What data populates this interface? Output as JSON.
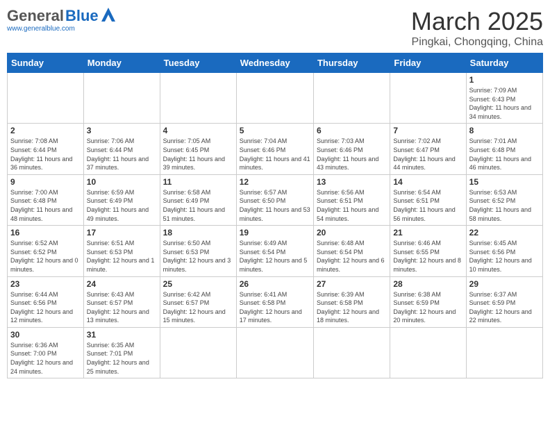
{
  "header": {
    "logo_general": "General",
    "logo_blue": "Blue",
    "month": "March 2025",
    "location": "Pingkai, Chongqing, China"
  },
  "weekdays": [
    "Sunday",
    "Monday",
    "Tuesday",
    "Wednesday",
    "Thursday",
    "Friday",
    "Saturday"
  ],
  "days": [
    {
      "date": null,
      "content": null
    },
    {
      "date": null,
      "content": null
    },
    {
      "date": null,
      "content": null
    },
    {
      "date": null,
      "content": null
    },
    {
      "date": null,
      "content": null
    },
    {
      "date": null,
      "content": null
    },
    {
      "date": "1",
      "sunrise": "7:09 AM",
      "sunset": "6:43 PM",
      "daylight": "11 hours and 34 minutes."
    },
    {
      "date": "2",
      "sunrise": "7:08 AM",
      "sunset": "6:44 PM",
      "daylight": "11 hours and 36 minutes."
    },
    {
      "date": "3",
      "sunrise": "7:06 AM",
      "sunset": "6:44 PM",
      "daylight": "11 hours and 37 minutes."
    },
    {
      "date": "4",
      "sunrise": "7:05 AM",
      "sunset": "6:45 PM",
      "daylight": "11 hours and 39 minutes."
    },
    {
      "date": "5",
      "sunrise": "7:04 AM",
      "sunset": "6:46 PM",
      "daylight": "11 hours and 41 minutes."
    },
    {
      "date": "6",
      "sunrise": "7:03 AM",
      "sunset": "6:46 PM",
      "daylight": "11 hours and 43 minutes."
    },
    {
      "date": "7",
      "sunrise": "7:02 AM",
      "sunset": "6:47 PM",
      "daylight": "11 hours and 44 minutes."
    },
    {
      "date": "8",
      "sunrise": "7:01 AM",
      "sunset": "6:48 PM",
      "daylight": "11 hours and 46 minutes."
    },
    {
      "date": "9",
      "sunrise": "7:00 AM",
      "sunset": "6:48 PM",
      "daylight": "11 hours and 48 minutes."
    },
    {
      "date": "10",
      "sunrise": "6:59 AM",
      "sunset": "6:49 PM",
      "daylight": "11 hours and 49 minutes."
    },
    {
      "date": "11",
      "sunrise": "6:58 AM",
      "sunset": "6:49 PM",
      "daylight": "11 hours and 51 minutes."
    },
    {
      "date": "12",
      "sunrise": "6:57 AM",
      "sunset": "6:50 PM",
      "daylight": "11 hours and 53 minutes."
    },
    {
      "date": "13",
      "sunrise": "6:56 AM",
      "sunset": "6:51 PM",
      "daylight": "11 hours and 54 minutes."
    },
    {
      "date": "14",
      "sunrise": "6:54 AM",
      "sunset": "6:51 PM",
      "daylight": "11 hours and 56 minutes."
    },
    {
      "date": "15",
      "sunrise": "6:53 AM",
      "sunset": "6:52 PM",
      "daylight": "11 hours and 58 minutes."
    },
    {
      "date": "16",
      "sunrise": "6:52 AM",
      "sunset": "6:52 PM",
      "daylight": "12 hours and 0 minutes."
    },
    {
      "date": "17",
      "sunrise": "6:51 AM",
      "sunset": "6:53 PM",
      "daylight": "12 hours and 1 minute."
    },
    {
      "date": "18",
      "sunrise": "6:50 AM",
      "sunset": "6:53 PM",
      "daylight": "12 hours and 3 minutes."
    },
    {
      "date": "19",
      "sunrise": "6:49 AM",
      "sunset": "6:54 PM",
      "daylight": "12 hours and 5 minutes."
    },
    {
      "date": "20",
      "sunrise": "6:48 AM",
      "sunset": "6:54 PM",
      "daylight": "12 hours and 6 minutes."
    },
    {
      "date": "21",
      "sunrise": "6:46 AM",
      "sunset": "6:55 PM",
      "daylight": "12 hours and 8 minutes."
    },
    {
      "date": "22",
      "sunrise": "6:45 AM",
      "sunset": "6:56 PM",
      "daylight": "12 hours and 10 minutes."
    },
    {
      "date": "23",
      "sunrise": "6:44 AM",
      "sunset": "6:56 PM",
      "daylight": "12 hours and 12 minutes."
    },
    {
      "date": "24",
      "sunrise": "6:43 AM",
      "sunset": "6:57 PM",
      "daylight": "12 hours and 13 minutes."
    },
    {
      "date": "25",
      "sunrise": "6:42 AM",
      "sunset": "6:57 PM",
      "daylight": "12 hours and 15 minutes."
    },
    {
      "date": "26",
      "sunrise": "6:41 AM",
      "sunset": "6:58 PM",
      "daylight": "12 hours and 17 minutes."
    },
    {
      "date": "27",
      "sunrise": "6:39 AM",
      "sunset": "6:58 PM",
      "daylight": "12 hours and 18 minutes."
    },
    {
      "date": "28",
      "sunrise": "6:38 AM",
      "sunset": "6:59 PM",
      "daylight": "12 hours and 20 minutes."
    },
    {
      "date": "29",
      "sunrise": "6:37 AM",
      "sunset": "6:59 PM",
      "daylight": "12 hours and 22 minutes."
    },
    {
      "date": "30",
      "sunrise": "6:36 AM",
      "sunset": "7:00 PM",
      "daylight": "12 hours and 24 minutes."
    },
    {
      "date": "31",
      "sunrise": "6:35 AM",
      "sunset": "7:01 PM",
      "daylight": "12 hours and 25 minutes."
    }
  ]
}
